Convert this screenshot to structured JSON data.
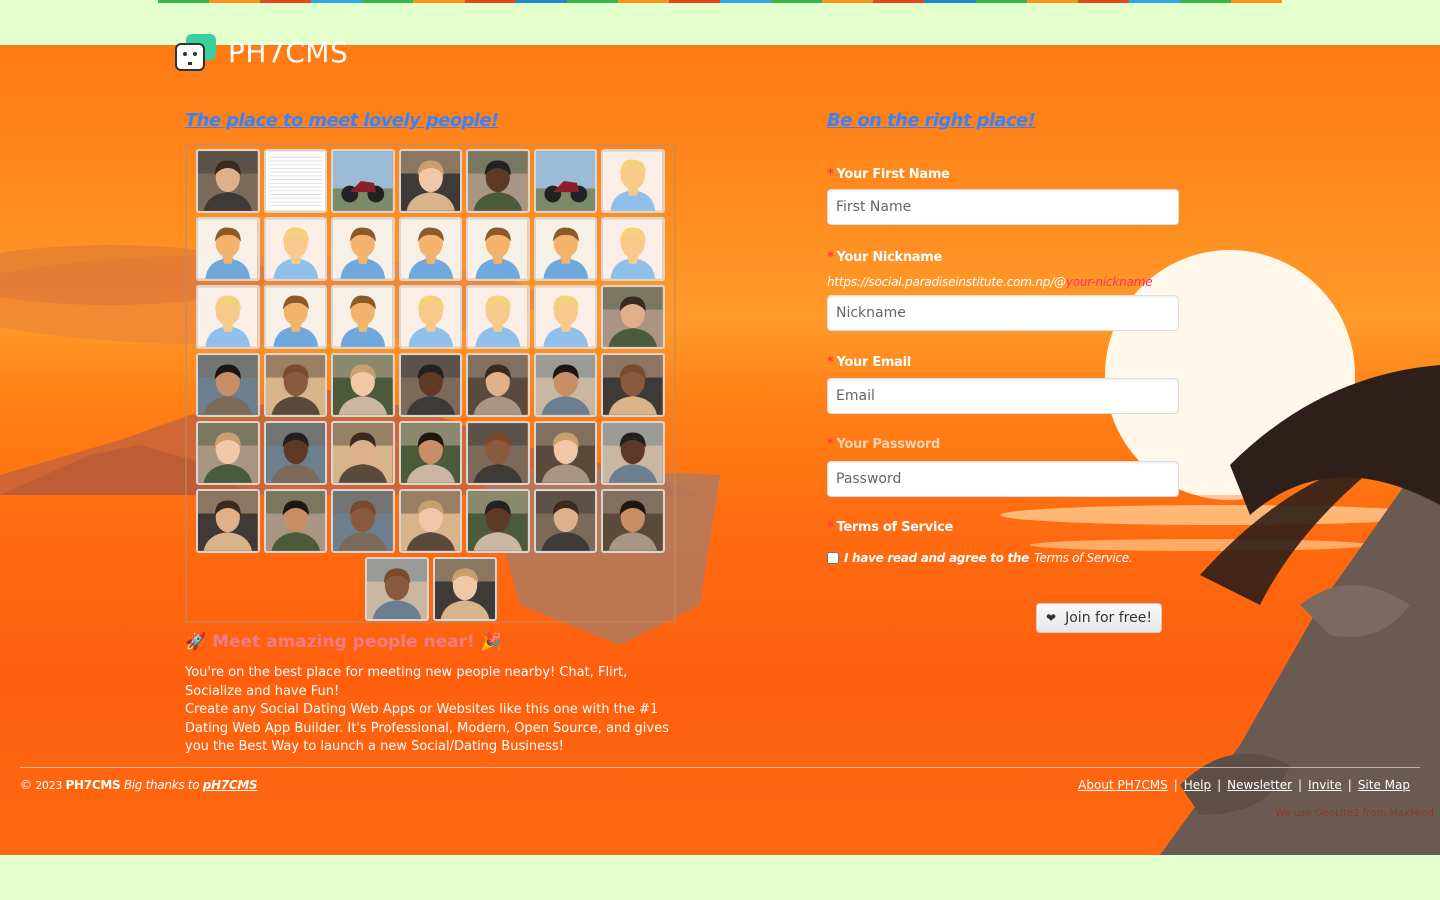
{
  "colors": {
    "stripe": [
      "#39b54a",
      "#f7931e",
      "#e8471c",
      "#29abe2",
      "#39b54a",
      "#f7931e",
      "#e8471c",
      "#1e88c8",
      "#39b54a",
      "#f7931e",
      "#e8471c",
      "#29abe2",
      "#39b54a",
      "#f7931e",
      "#e8471c",
      "#1e88c8",
      "#39b54a",
      "#f7931e",
      "#e8471c",
      "#29abe2",
      "#39b54a",
      "#f7931e"
    ],
    "link_blue": "#3b82f6",
    "pink": "#f17b86",
    "required": "#ff3b3b"
  },
  "header": {
    "logo_text": "PH7CMS",
    "logo_icon": "chat-bubble-logo-icon"
  },
  "left": {
    "title": "The place to meet lovely people!",
    "avatar_rows": [
      [
        "man-blonde",
        "screenshot",
        "motorbike-riders",
        "man-selfie",
        "man-blonde",
        "motorbike",
        "default-female"
      ],
      [
        "default-male",
        "default-female",
        "default-male",
        "default-male",
        "default-male",
        "default-male",
        "default-female"
      ],
      [
        "default-female",
        "default-male",
        "default-male",
        "default-female",
        "default-female",
        "default-female",
        "man-beard"
      ],
      [
        "woman-dark",
        "man-bald",
        "woman-asian",
        "woman-brunette",
        "man-hand",
        "man-young",
        "woman-curly"
      ],
      [
        "woman-asian-2",
        "man-glasses",
        "woman-brunette-2",
        "woman-brunette-3",
        "man-beard-2",
        "man-outdoor",
        "man-bald-2"
      ],
      [
        "man-tshirt",
        "man-glasses-2",
        "man-smile",
        "woman-redhead",
        "man-laugh",
        "man-dark",
        "woman-glasses"
      ],
      [
        "man-outdoor-2",
        "man-young-2"
      ]
    ],
    "meet_heading": "Meet amazing people near!",
    "meet_icon_left": "rocket-icon",
    "meet_icon_right": "party-popper-icon",
    "desc1": "You're on the best place for meeting new people nearby! Chat, Flirt, Socialize and have Fun!",
    "desc2": "Create any Social Dating Web Apps or Websites like this one with the #1 Dating Web App Builder. It's Professional, Modern, Open Source, and gives you the Best Way to launch a new Social/Dating Business!"
  },
  "form": {
    "title": "Be on the right place!",
    "required_mark": "*",
    "first_name_label": "Your First Name",
    "first_name_placeholder": "First Name",
    "nickname_label": "Your Nickname",
    "nickname_url_prefix": "https://social.paradiseinstitute.com.np/@",
    "nickname_url_suffix": "your-nickname",
    "nickname_placeholder": "Nickname",
    "email_label": "Your Email",
    "email_placeholder": "Email",
    "password_label": "Your Password",
    "password_placeholder": "Password",
    "terms_label": "Terms of Service",
    "terms_text": "I have read and agree to the",
    "terms_link": "Terms of Service.",
    "join_label": "Join for free!",
    "join_icon": "heart-icon"
  },
  "footer": {
    "copyright_symbol": "©",
    "year": "2023",
    "brand": "PH7CMS",
    "thanks": "Big thanks to",
    "thanks_link": "pH7CMS",
    "nav": [
      "About PH7CMS",
      "Help",
      "Newsletter",
      "Invite",
      "Site Map"
    ],
    "separators": [
      "|",
      "|",
      "|",
      "|"
    ],
    "geo_note": "We use GeoLite2 from MaxMind"
  }
}
